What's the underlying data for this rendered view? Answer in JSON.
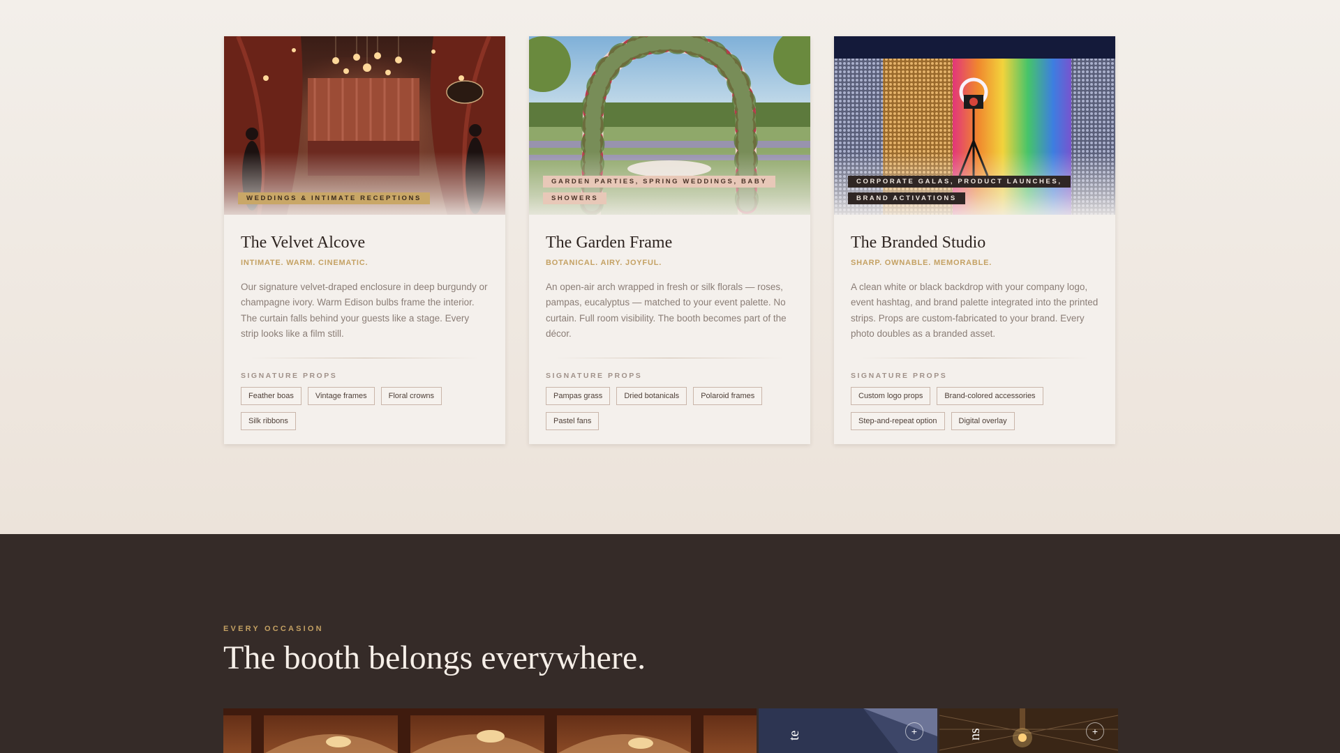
{
  "cards": [
    {
      "tag": "WEDDINGS & INTIMATE RECEPTIONS",
      "title": "The Velvet Alcove",
      "subtitle": "INTIMATE. WARM. CINEMATIC.",
      "description": "Our signature velvet-draped enclosure in deep burgundy or champagne ivory. Warm Edison bulbs frame the interior. The curtain falls behind your guests like a stage. Every strip looks like a film still.",
      "props_label": "SIGNATURE PROPS",
      "props": [
        "Feather boas",
        "Vintage frames",
        "Floral crowns",
        "Silk ribbons"
      ]
    },
    {
      "tag": "GARDEN PARTIES, SPRING WEDDINGS, BABY SHOWERS",
      "title": "The Garden Frame",
      "subtitle": "BOTANICAL. AIRY. JOYFUL.",
      "description": "An open-air arch wrapped in fresh or silk florals — roses, pampas, eucalyptus — matched to your event palette. No curtain. Full room visibility. The booth becomes part of the décor.",
      "props_label": "SIGNATURE PROPS",
      "props": [
        "Pampas grass",
        "Dried botanicals",
        "Polaroid frames",
        "Pastel fans"
      ]
    },
    {
      "tag": "CORPORATE GALAS, PRODUCT LAUNCHES, BRAND ACTIVATIONS",
      "title": "The Branded Studio",
      "subtitle": "SHARP. OWNABLE. MEMORABLE.",
      "description": "A clean white or black backdrop with your company logo, event hashtag, and brand palette integrated into the printed strips. Props are custom-fabricated to your brand. Every photo doubles as a branded asset.",
      "props_label": "SIGNATURE PROPS",
      "props": [
        "Custom logo props",
        "Brand-colored accessories",
        "Step-and-repeat option",
        "Digital overlay"
      ]
    }
  ],
  "occasions": {
    "eyebrow": "EVERY OCCASION",
    "headline": "The booth belongs everywhere.",
    "tile_labels": [
      "te",
      "ns"
    ]
  },
  "colors": {
    "accent_gold": "#c4a163",
    "dark_bg": "#352b28",
    "page_bg": "#f3eee9"
  }
}
